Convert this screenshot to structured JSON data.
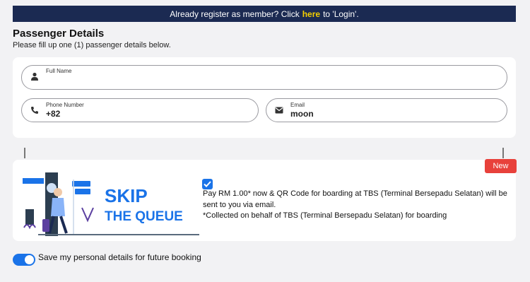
{
  "banner": {
    "text_before": "Already register as member? Click",
    "link": "here",
    "text_after": "to 'Login'.",
    "link_color": "#f5d000",
    "bg_color": "#1b2a52"
  },
  "section": {
    "title": "Passenger Details",
    "subtitle": "Please fill up one (1) passenger details below."
  },
  "form": {
    "full_name": {
      "label": "Full Name",
      "value": "",
      "icon": "person-icon"
    },
    "phone": {
      "label": "Phone Number",
      "value": "+82",
      "icon": "phone-icon"
    },
    "email": {
      "label": "Email",
      "value": "moon",
      "icon": "envelope-icon"
    }
  },
  "promo": {
    "badge": "New",
    "illustration_title_1": "SKIP",
    "illustration_title_2": "THE QUEUE",
    "checked": true,
    "line1": "Pay RM 1.00* now & QR Code for boarding at TBS (Terminal Bersepadu Selatan) will be sent to you via email.",
    "line2": "*Collected on behalf of TBS (Terminal Bersepadu Selatan) for boarding",
    "accent_color": "#1a73e8",
    "badge_color": "#e8413b"
  },
  "save_details": {
    "label": "Save my personal details for future booking",
    "enabled": true
  }
}
